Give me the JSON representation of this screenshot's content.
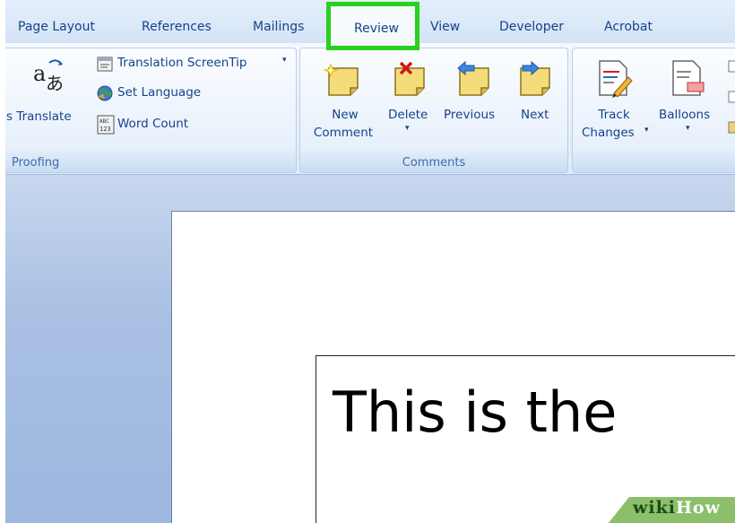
{
  "tabs": [
    "Page Layout",
    "References",
    "Mailings",
    "Review",
    "View",
    "Developer",
    "Acrobat"
  ],
  "active_tab": "Review",
  "highlight_color": "#27d11d",
  "proofing": {
    "translate_label": "s Translate",
    "translation_screentip": "Translation ScreenTip",
    "set_language": "Set Language",
    "word_count": "Word Count",
    "group_label": "Proofing"
  },
  "comments": {
    "new_line1": "New",
    "new_line2": "Comment",
    "delete": "Delete",
    "previous": "Previous",
    "next": "Next",
    "group_label": "Comments"
  },
  "tracking": {
    "track_line1": "Track",
    "track_line2": "Changes",
    "balloons": "Balloons"
  },
  "document": {
    "text": "This is the"
  },
  "watermark": {
    "part1": "wiki",
    "part2": "How"
  },
  "icons": [
    "translate-icon",
    "translation-screentip-icon",
    "set-language-icon",
    "word-count-icon",
    "new-comment-icon",
    "delete-comment-icon",
    "previous-comment-icon",
    "next-comment-icon",
    "track-changes-icon",
    "balloons-icon"
  ]
}
